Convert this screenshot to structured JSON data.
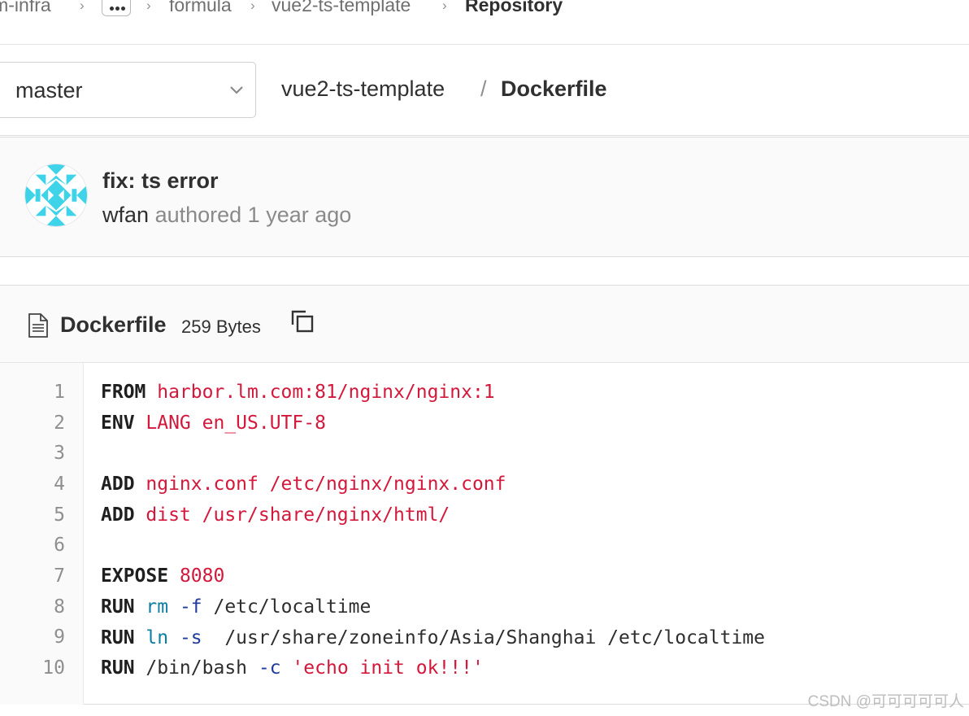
{
  "breadcrumb": {
    "group": "lm-infra",
    "ellipsis": "...",
    "subgroup": "formula",
    "project": "vue2-ts-template",
    "current": "Repository"
  },
  "ref": {
    "branch": "master"
  },
  "path": {
    "project": "vue2-ts-template",
    "separator": "/",
    "file": "Dockerfile"
  },
  "commit": {
    "title": "fix: ts error",
    "author": "wfan",
    "action": "authored",
    "time": "1 year ago"
  },
  "file": {
    "name": "Dockerfile",
    "size": "259 Bytes"
  },
  "code": {
    "line_numbers": [
      "1",
      "2",
      "3",
      "4",
      "5",
      "6",
      "7",
      "8",
      "9",
      "10"
    ],
    "l1": {
      "kw": "FROM",
      "arg": " harbor.lm.com:81/nginx/nginx:1"
    },
    "l2": {
      "kw": "ENV",
      "arg": " LANG en_US.UTF-8"
    },
    "l4": {
      "kw": "ADD",
      "arg": " nginx.conf /etc/nginx/nginx.conf"
    },
    "l5": {
      "kw": "ADD",
      "arg": " dist /usr/share/nginx/html/"
    },
    "l7": {
      "kw": "EXPOSE",
      "arg": " 8080"
    },
    "l8": {
      "kw": "RUN",
      "cmd": " rm",
      "flag": " -f",
      "rest": " /etc/localtime"
    },
    "l9": {
      "kw": "RUN",
      "cmd": " ln",
      "flag": " -s",
      "rest": "  /usr/share/zoneinfo/Asia/Shanghai /etc/localtime"
    },
    "l10": {
      "kw": "RUN",
      "pre": " /bin/bash",
      "flag": " -c",
      "str": " 'echo init ok!!!'"
    }
  },
  "watermark": "CSDN @可可可可可人",
  "colors": {
    "string": "#d4183b",
    "command": "#0d7ea3",
    "flag": "#1f3a9c",
    "avatar_pattern": "#3fd3ea"
  },
  "icons": {
    "branch_dropdown": "chevron-down-icon",
    "file": "file-icon",
    "copy": "copy-icon"
  }
}
